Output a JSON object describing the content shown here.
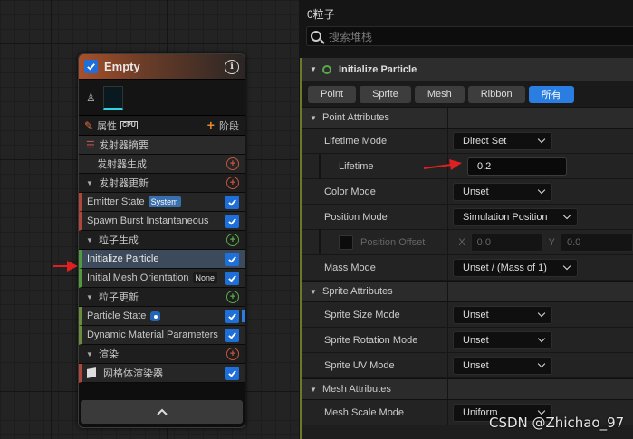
{
  "node": {
    "title": "Empty",
    "properties_label": "属性",
    "cpu_label": "CPU",
    "stage_label": "阶段",
    "rows": {
      "emitter_summary": "发射器摘要",
      "emitter_spawn": "发射器生成",
      "emitter_update": "发射器更新",
      "emitter_state": "Emitter State",
      "system_tag": "System",
      "spawn_burst": "Spawn Burst Instantaneous",
      "particle_spawn": "粒子生成",
      "initialize_particle": "Initialize Particle",
      "initial_mesh_orientation": "Initial Mesh Orientation",
      "none_tag": "None",
      "particle_update": "粒子更新",
      "particle_state": "Particle State",
      "dynamic_material": "Dynamic Material Parameters",
      "render": "渲染",
      "mesh_renderer": "网格体渲染器"
    }
  },
  "panel": {
    "particles_count": "0粒子",
    "search_placeholder": "搜索堆栈",
    "section_title": "Initialize Particle",
    "tabs": [
      "Point",
      "Sprite",
      "Mesh",
      "Ribbon",
      "所有"
    ],
    "active_tab": "所有",
    "point_attributes": {
      "header": "Point Attributes",
      "lifetime_mode_label": "Lifetime Mode",
      "lifetime_mode_value": "Direct Set",
      "lifetime_label": "Lifetime",
      "lifetime_value": "0.2",
      "color_mode_label": "Color Mode",
      "color_mode_value": "Unset",
      "position_mode_label": "Position Mode",
      "position_mode_value": "Simulation Position",
      "position_offset_label": "Position Offset",
      "x_label": "X",
      "x_value": "0.0",
      "y_label": "Y",
      "y_value": "0.0",
      "mass_mode_label": "Mass Mode",
      "mass_mode_value": "Unset / (Mass of 1)"
    },
    "sprite_attributes": {
      "header": "Sprite Attributes",
      "size_mode_label": "Sprite Size Mode",
      "size_mode_value": "Unset",
      "rotation_mode_label": "Sprite Rotation Mode",
      "rotation_mode_value": "Unset",
      "uv_mode_label": "Sprite UV Mode",
      "uv_mode_value": "Unset"
    },
    "mesh_attributes": {
      "header": "Mesh Attributes",
      "scale_mode_label": "Mesh Scale Mode",
      "scale_mode_value": "Uniform"
    }
  },
  "watermark": "CSDN @Zhichao_97",
  "colors": {
    "accent_blue": "#2a7de1",
    "arrow_red": "#e02020",
    "node_header_orange": "#a8502a"
  }
}
